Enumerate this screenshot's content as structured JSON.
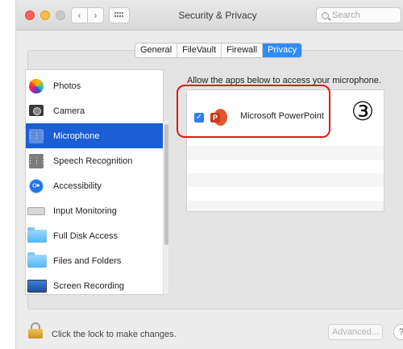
{
  "window": {
    "title": "Security & Privacy",
    "search_placeholder": "Search"
  },
  "tabs": [
    {
      "label": "General",
      "active": false
    },
    {
      "label": "FileVault",
      "active": false
    },
    {
      "label": "Firewall",
      "active": false
    },
    {
      "label": "Privacy",
      "active": true
    }
  ],
  "sidebar": {
    "items": [
      {
        "label": "Photos",
        "icon": "photos-icon"
      },
      {
        "label": "Camera",
        "icon": "camera-icon"
      },
      {
        "label": "Microphone",
        "icon": "microphone-waveform-icon",
        "selected": true
      },
      {
        "label": "Speech Recognition",
        "icon": "speech-waveform-icon"
      },
      {
        "label": "Accessibility",
        "icon": "accessibility-icon"
      },
      {
        "label": "Input Monitoring",
        "icon": "keyboard-icon"
      },
      {
        "label": "Full Disk Access",
        "icon": "folder-icon"
      },
      {
        "label": "Files and Folders",
        "icon": "folder-icon"
      },
      {
        "label": "Screen Recording",
        "icon": "screen-icon"
      }
    ]
  },
  "main": {
    "description": "Allow the apps below to access your microphone.",
    "apps": [
      {
        "name": "Microsoft PowerPoint",
        "checked": true,
        "icon": "powerpoint-icon"
      }
    ]
  },
  "annotation": {
    "step_marker": "③",
    "highlight_color": "#e0191c"
  },
  "footer": {
    "lock_text": "Click the lock to make changes.",
    "advanced_label": "Advanced...",
    "help_label": "?"
  },
  "colors": {
    "accent": "#2f8bf7",
    "selection": "#1a5fd5"
  }
}
